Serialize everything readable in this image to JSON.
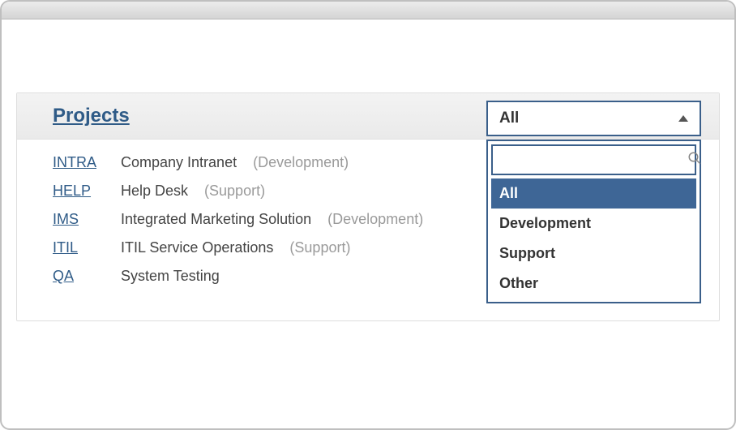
{
  "panel": {
    "title": "Projects"
  },
  "filter": {
    "selected": "All",
    "search_value": "",
    "options": [
      "All",
      "Development",
      "Support",
      "Other"
    ]
  },
  "projects": [
    {
      "code": "INTRA",
      "name": "Company Intranet",
      "category": "(Development)"
    },
    {
      "code": "HELP",
      "name": "Help Desk",
      "category": "(Support)"
    },
    {
      "code": "IMS",
      "name": "Integrated Marketing Solution",
      "category": "(Development)"
    },
    {
      "code": "ITIL",
      "name": "ITIL Service Operations",
      "category": "(Support)"
    },
    {
      "code": "QA",
      "name": "System Testing",
      "category": ""
    }
  ]
}
